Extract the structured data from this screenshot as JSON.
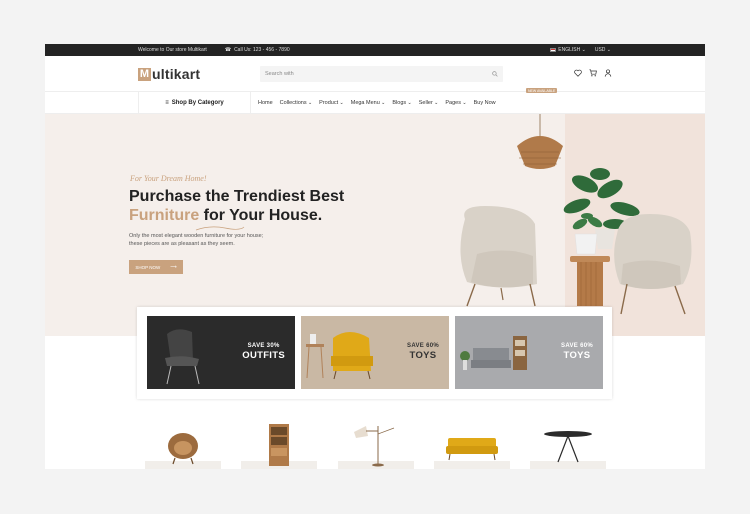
{
  "topbar": {
    "welcome": "Welcome to Our store Multikart",
    "phone": "Call Us: 123 - 456 - 7890",
    "language": "ENGLISH",
    "currency": "USD"
  },
  "header": {
    "logo_initial": "M",
    "logo_rest": "ultikart",
    "search_placeholder": "Search with"
  },
  "nav": {
    "category_label": "Shop By Category",
    "items": [
      {
        "label": "Home",
        "has_dropdown": false
      },
      {
        "label": "Collections",
        "has_dropdown": true
      },
      {
        "label": "Product",
        "has_dropdown": true
      },
      {
        "label": "Mega Menu",
        "has_dropdown": true
      },
      {
        "label": "Blogs",
        "has_dropdown": true
      },
      {
        "label": "Seller",
        "has_dropdown": true
      },
      {
        "label": "Pages",
        "has_dropdown": true
      },
      {
        "label": "Buy Now",
        "has_dropdown": false
      }
    ],
    "badge": "NEW AVAILABLE"
  },
  "hero": {
    "tagline": "For Your Dream Home!",
    "headline_line1": "Purchase the Trendiest Best",
    "headline_accent": "Furniture",
    "headline_line2_rest": " for Your House.",
    "subtext_line1": "Only the most elegant wooden furniture for your house;",
    "subtext_line2": "these pieces are as pleasant as they seem.",
    "button": "SHOP NOW"
  },
  "banners": [
    {
      "save": "SAVE 30%",
      "title": "OUTFITS",
      "bg": "#2b2b2b",
      "text_color": "#ffffff"
    },
    {
      "save": "SAVE 60%",
      "title": "TOYS",
      "bg": "#c9b8a4",
      "text_color": "#333333"
    },
    {
      "save": "SAVE 60%",
      "title": "TOYS",
      "bg": "#a9aaad",
      "text_color": "#ffffff"
    }
  ],
  "colors": {
    "accent": "#c9a27e",
    "topbar": "#232323",
    "hero_bg": "#f5efeb"
  }
}
